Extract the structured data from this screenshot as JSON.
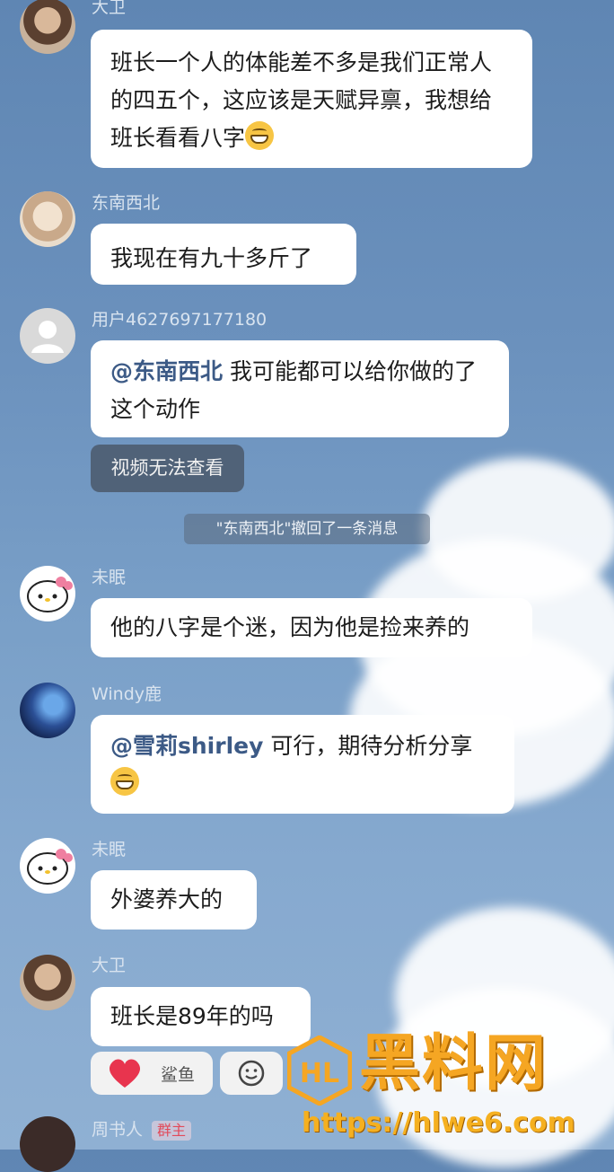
{
  "messages": [
    {
      "sender": "大卫",
      "text": "班长一个人的体能差不多是我们正常人的四五个，这应该是天赋异禀，我想给班长看看八字",
      "emoji": "grinning-face-emoji"
    },
    {
      "sender": "东南西北",
      "text": "我现在有九十多斤了"
    },
    {
      "sender": "用户4627697177180",
      "mention": "@东南西北",
      "text": " 我可能都可以给你做的了这个动作",
      "attachment": "视频无法查看"
    },
    {
      "sender": "未眠",
      "text": "他的八字是个迷，因为他是捡来养的"
    },
    {
      "sender": "Windy鹿",
      "mention": "@雪莉shirley",
      "text": " 可行，期待分析分享",
      "emoji": "grinning-face-emoji"
    },
    {
      "sender": "未眠",
      "text": "外婆养大的"
    },
    {
      "sender": "大卫",
      "text": "班长是89年的吗"
    },
    {
      "sender": "周书人",
      "badge": "群主"
    }
  ],
  "system_notice": "\"东南西北\"撤回了一条消息",
  "reactions": {
    "heart_user": "鲨鱼"
  },
  "watermark": {
    "brand": "黑料网",
    "url": "https://hlwe6.com",
    "logo_letters": "HL"
  }
}
